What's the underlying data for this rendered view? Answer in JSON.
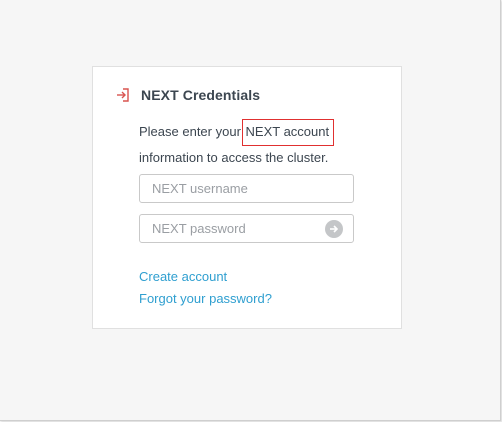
{
  "panel": {
    "title": "NEXT Credentials",
    "description_before": "Please enter your ",
    "description_highlight": "NEXT account",
    "description_after": "information to access the cluster.",
    "icon": "login-arrow-icon"
  },
  "form": {
    "username_placeholder": "NEXT username",
    "username_value": "",
    "password_placeholder": "NEXT password",
    "password_value": "",
    "submit_icon": "arrow-right-circle-icon"
  },
  "links": {
    "create_account": "Create account",
    "forgot_password": "Forgot your password?"
  },
  "colors": {
    "accent_link": "#2f9fd0",
    "icon_red": "#d9534f",
    "highlight_border": "#e03030",
    "background": "#f6f6f6"
  }
}
